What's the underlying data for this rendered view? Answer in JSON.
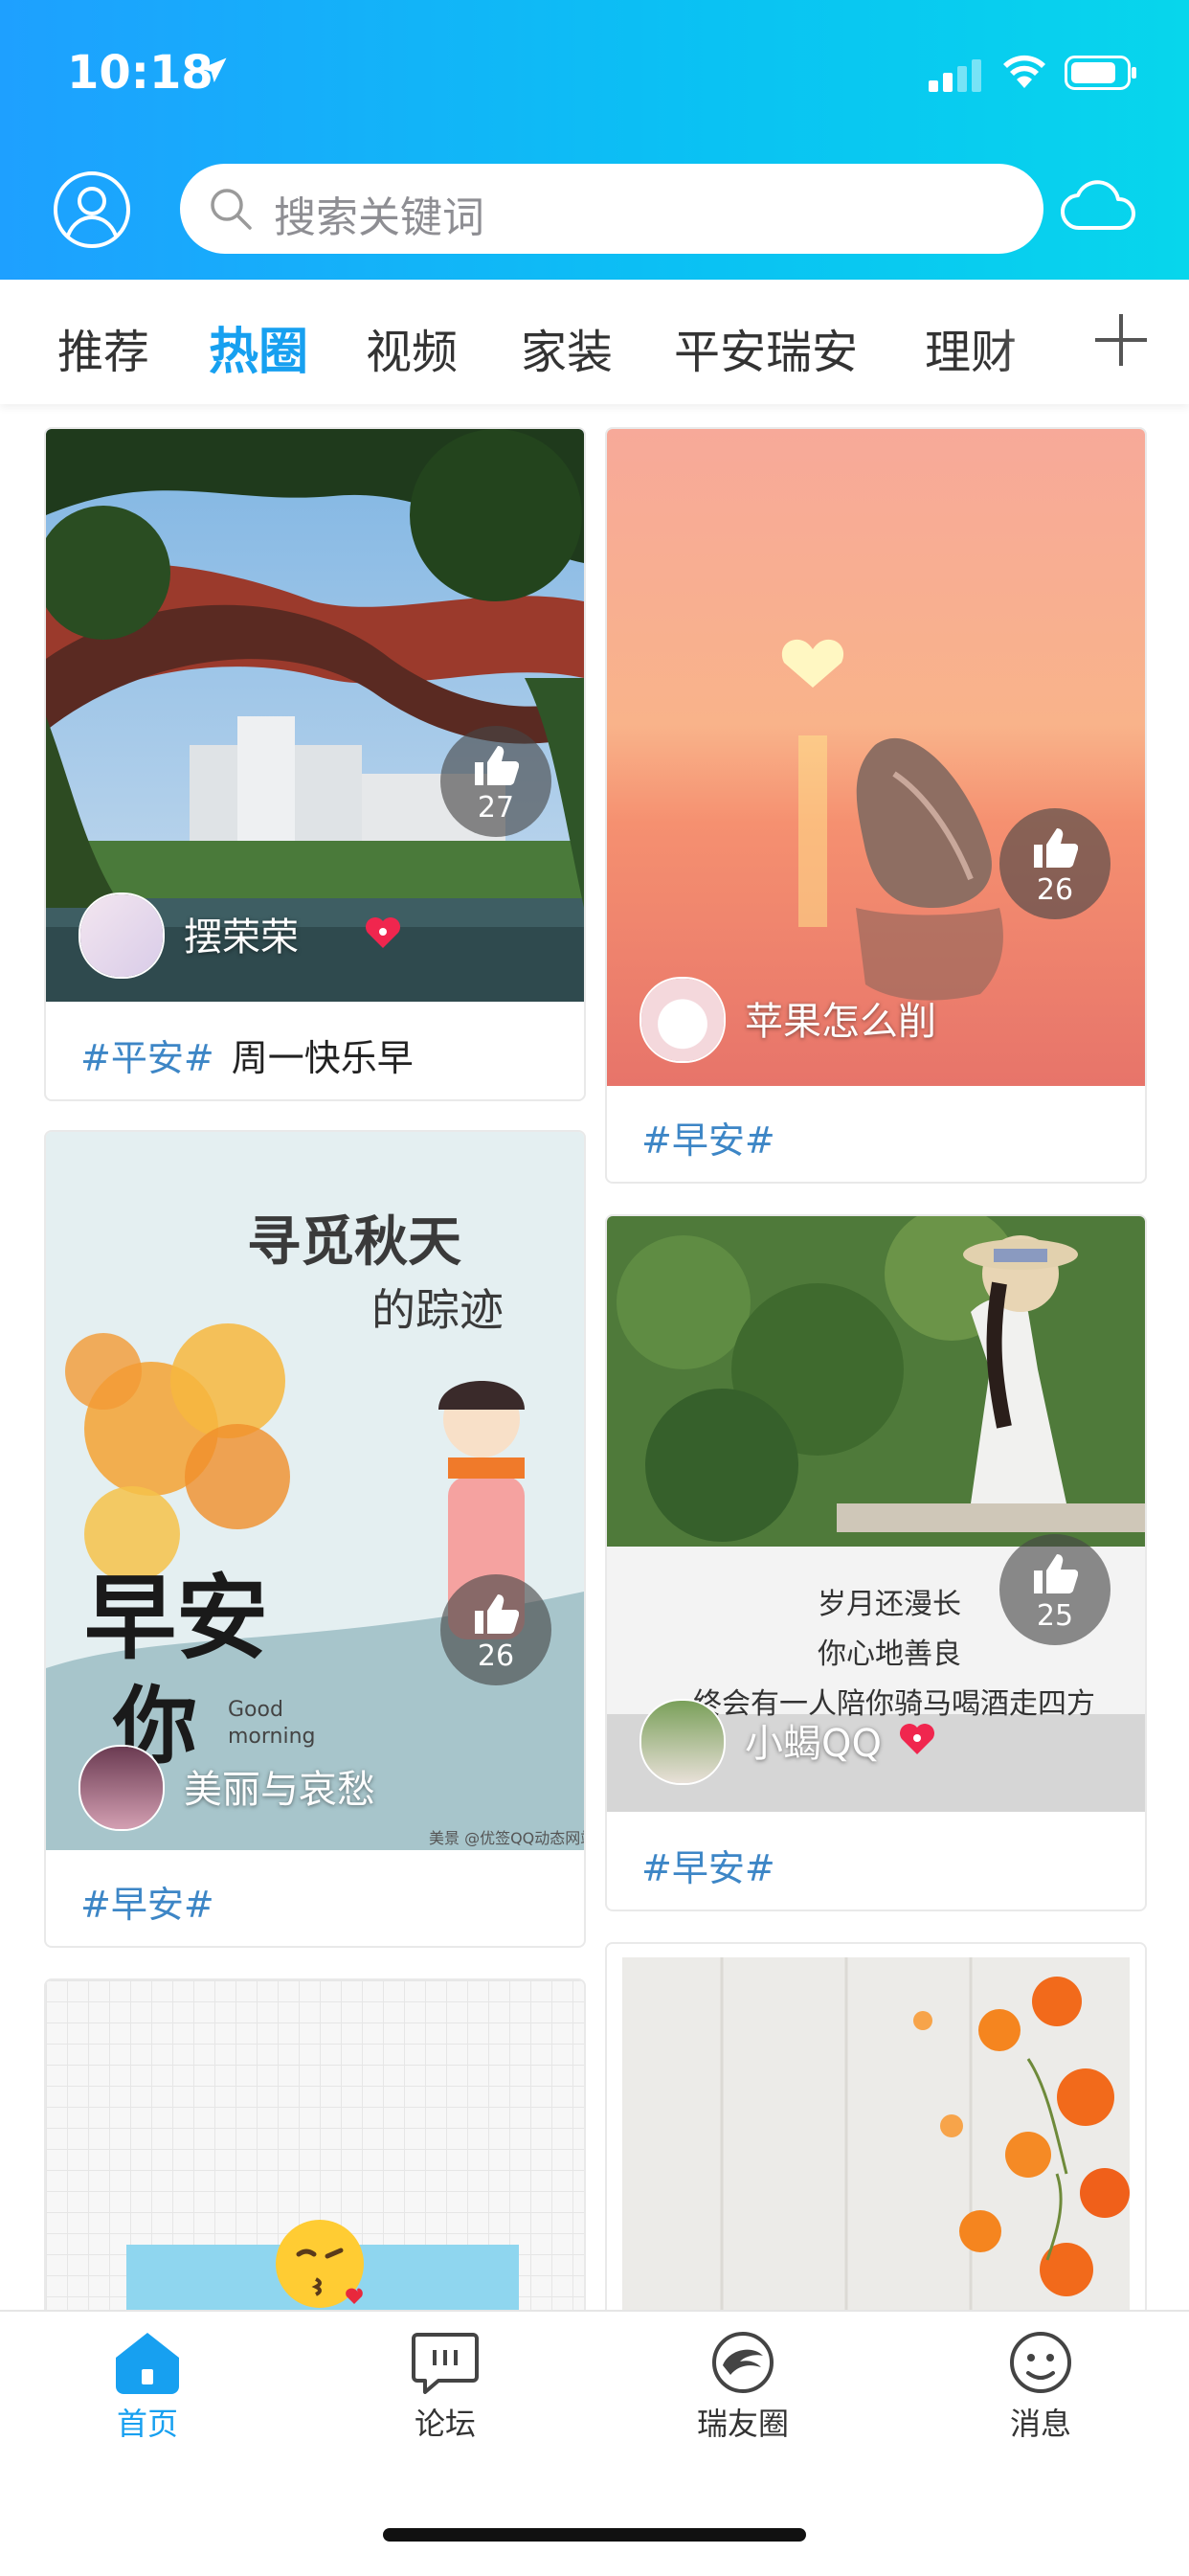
{
  "status_bar": {
    "time": "10:18"
  },
  "search": {
    "placeholder": "搜索关键词"
  },
  "tabs": [
    {
      "label": "推荐",
      "active": false
    },
    {
      "label": "热圈",
      "active": true
    },
    {
      "label": "视频",
      "active": false
    },
    {
      "label": "家装",
      "active": false
    },
    {
      "label": "平安瑞安",
      "active": false
    },
    {
      "label": "理财",
      "active": false
    }
  ],
  "feed": {
    "cards": [
      {
        "likes": "27",
        "user": "摆荣荣",
        "tag": "#平安#",
        "text": "周一快乐早"
      },
      {
        "likes": "26",
        "user": "苹果怎么削",
        "tag": "#早安#",
        "text": ""
      },
      {
        "likes": "26",
        "user": "美丽与哀愁",
        "tag": "#早安#",
        "text": "",
        "image_text": {
          "title1": "寻觅秋天",
          "title2": "的踪迹",
          "big": "早安",
          "big2": "你",
          "small": "Good morning",
          "credit": "美景 @优签QQ动态网站"
        }
      },
      {
        "likes": "25",
        "user": "小蝎QQ",
        "tag": "#早安#",
        "text": "",
        "image_text": {
          "line1": "岁月还漫长",
          "line2": "你心地善良",
          "line3": "终会有一人陪你骑马喝酒走四方"
        }
      },
      {
        "likes": "",
        "user": "",
        "tag": "",
        "text": ""
      },
      {
        "likes": "",
        "user": "",
        "tag": "",
        "text": ""
      }
    ]
  },
  "tabbar": {
    "items": [
      {
        "label": "首页",
        "icon": "home-icon",
        "active": true
      },
      {
        "label": "论坛",
        "icon": "chat-bubble-icon",
        "active": false
      },
      {
        "label": "瑞友圈",
        "icon": "ruiyou-logo-icon",
        "active": false
      },
      {
        "label": "消息",
        "icon": "smiley-icon",
        "active": false
      }
    ]
  },
  "colors": {
    "accent": "#17a0f0",
    "tag": "#3d86c6",
    "header_start": "#1ea0ff",
    "header_end": "#07d6ec"
  }
}
